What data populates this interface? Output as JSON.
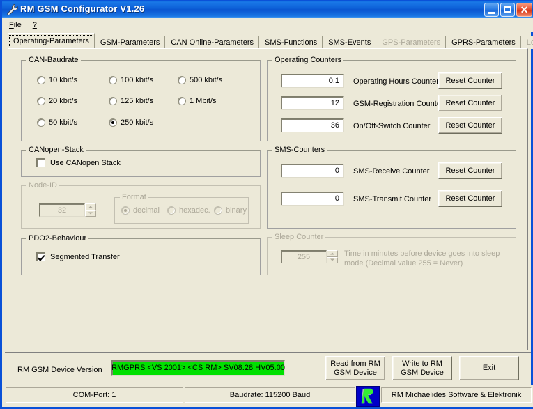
{
  "window": {
    "title": "RM GSM Configurator V1.26",
    "icon": "wrench-icon",
    "minimize": "_",
    "maximize": "□",
    "close": "✕",
    "accent_color": "#0a51d8"
  },
  "menu": {
    "items": [
      {
        "label": "File",
        "mnemonic": "F"
      },
      {
        "label": "?",
        "mnemonic": "?"
      }
    ]
  },
  "tabs": [
    {
      "label": "Operating-Parameters",
      "active": true,
      "disabled": false
    },
    {
      "label": "GSM-Parameters",
      "active": false,
      "disabled": false
    },
    {
      "label": "CAN Online-Parameters",
      "active": false,
      "disabled": false
    },
    {
      "label": "SMS-Functions",
      "active": false,
      "disabled": false
    },
    {
      "label": "SMS-Events",
      "active": false,
      "disabled": false
    },
    {
      "label": "GPS-Parameters",
      "active": false,
      "disabled": true
    },
    {
      "label": "GPRS-Parameters",
      "active": false,
      "disabled": false
    },
    {
      "label": "Logging",
      "active": false,
      "disabled": true
    }
  ],
  "can_baudrate": {
    "legend": "CAN-Baudrate",
    "options": [
      {
        "label": "10 kbit/s",
        "checked": false
      },
      {
        "label": "100 kbit/s",
        "checked": false
      },
      {
        "label": "500 kbit/s",
        "checked": false
      },
      {
        "label": "20 kbit/s",
        "checked": false
      },
      {
        "label": "125 kbit/s",
        "checked": false
      },
      {
        "label": "1 Mbit/s",
        "checked": false
      },
      {
        "label": "50 kbit/s",
        "checked": false
      },
      {
        "label": "250 kbit/s",
        "checked": true
      }
    ],
    "selected": "250 kbit/s"
  },
  "canopen_stack": {
    "legend": "CANopen-Stack",
    "checkbox_label": "Use CANopen Stack",
    "checked": false
  },
  "node_id": {
    "legend": "Node-ID",
    "value": "32",
    "disabled": true,
    "format": {
      "legend": "Format",
      "options": [
        {
          "label": "decimal",
          "checked": true
        },
        {
          "label": "hexadec.",
          "checked": false
        },
        {
          "label": "binary",
          "checked": false
        }
      ],
      "selected": "decimal"
    }
  },
  "pdo2_behaviour": {
    "legend": "PDO2-Behaviour",
    "checkbox_label": "Segmented Transfer",
    "checked": true
  },
  "operating_counters": {
    "legend": "Operating Counters",
    "rows": [
      {
        "value": "0,1",
        "label": "Operating Hours Counter",
        "button": "Reset Counter"
      },
      {
        "value": "12",
        "label": "GSM-Registration Counter",
        "button": "Reset Counter"
      },
      {
        "value": "36",
        "label": "On/Off-Switch Counter",
        "button": "Reset Counter"
      }
    ]
  },
  "sms_counters": {
    "legend": "SMS-Counters",
    "rows": [
      {
        "value": "0",
        "label": "SMS-Receive Counter",
        "button": "Reset Counter"
      },
      {
        "value": "0",
        "label": "SMS-Transmit Counter",
        "button": "Reset Counter"
      }
    ]
  },
  "sleep_counter": {
    "legend": "Sleep Counter",
    "value": "255",
    "disabled": true,
    "description_line1": "Time in minutes before device goes into sleep",
    "description_line2": "mode  (Decimal value 255 = Never)"
  },
  "device_version": {
    "label": "RM GSM Device Version",
    "value": "RMGPRS  <VS 2001> <CS RM> SV08.28 HV05.00",
    "background_color": "#00e000"
  },
  "actions": {
    "read": "Read from RM\nGSM Device",
    "write": "Write to RM\nGSM Device",
    "exit": "Exit"
  },
  "statusbar": {
    "com_port": "COM-Port:  1",
    "baudrate": "Baudrate: 115200 Baud",
    "company": "RM Michaelides Software & Elektronik",
    "logo": "rm-logo-icon"
  }
}
